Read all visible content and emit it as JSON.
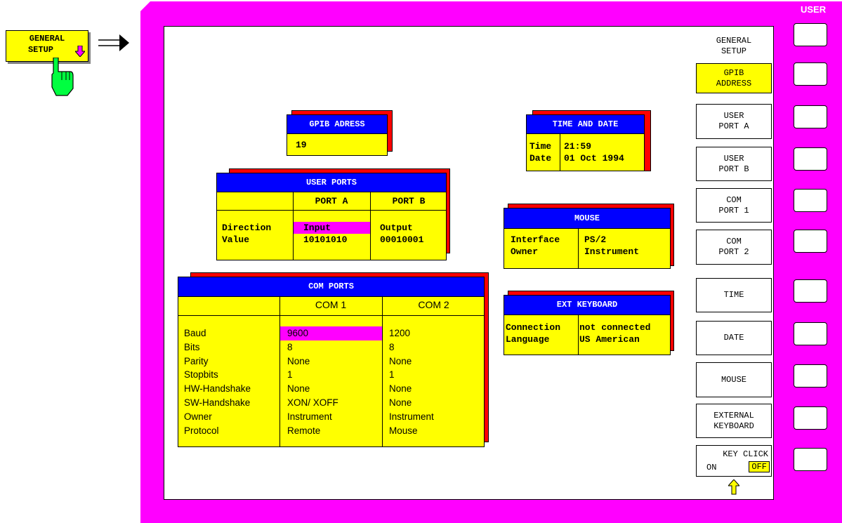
{
  "general_key": {
    "label_line1": "GENERAL",
    "label_line2": "SETUP"
  },
  "frame": {
    "user_label": "USER"
  },
  "menu": {
    "title": "GENERAL\nSETUP",
    "softkeys": [
      {
        "label": "GPIB\nADDRESS",
        "active": true
      },
      {
        "label": "USER\nPORT A",
        "active": false
      },
      {
        "label": "USER\nPORT B",
        "active": false
      },
      {
        "label": "COM\nPORT 1",
        "active": false
      },
      {
        "label": "COM\nPORT 2",
        "active": false
      },
      {
        "label": "TIME",
        "active": false
      },
      {
        "label": "DATE",
        "active": false
      },
      {
        "label": "MOUSE",
        "active": false
      },
      {
        "label": "EXTERNAL\nKEYBOARD",
        "active": false
      }
    ],
    "key_click": {
      "label": "KEY CLICK",
      "on": "ON",
      "off": "OFF",
      "selected": "OFF"
    }
  },
  "gpib": {
    "title": "GPIB ADRESS",
    "value": "19"
  },
  "time_date": {
    "title": "TIME AND DATE",
    "labels": "Time\nDate",
    "values": "21:59\n01 Oct 1994"
  },
  "user_ports": {
    "title": "USER PORTS",
    "port_a": "PORT A",
    "port_b": "PORT B",
    "row_labels": "Direction\nValue",
    "a_direction": "Input",
    "a_value": "10101010",
    "b_values": "Output\n00010001"
  },
  "mouse": {
    "title": "MOUSE",
    "labels": "Interface\nOwner",
    "values": "PS/2\nInstrument"
  },
  "ext_keyboard": {
    "title": "EXT KEYBOARD",
    "labels": "Connection\nLanguage",
    "values": "not connected\nUS American"
  },
  "com_ports": {
    "title": "COM PORTS",
    "com1": "COM 1",
    "com2": "COM 2",
    "row_labels": "Baud\nBits\nParity\nStopbits\nHW-Handshake\nSW-Handshake\nOwner\nProtocol",
    "com1_baud": "9600",
    "com1_rest": "8\nNone\n1\nNone\nXON/ XOFF\nInstrument\nRemote",
    "com2_values": "1200\n8\nNone\n1\nNone\nNone\nInstrument\nMouse"
  },
  "colors": {
    "frame": "#ff00ff",
    "panel": "#ffff00",
    "header": "#0000ff",
    "shadow": "#ff0000",
    "highlight": "#ff00ff"
  }
}
